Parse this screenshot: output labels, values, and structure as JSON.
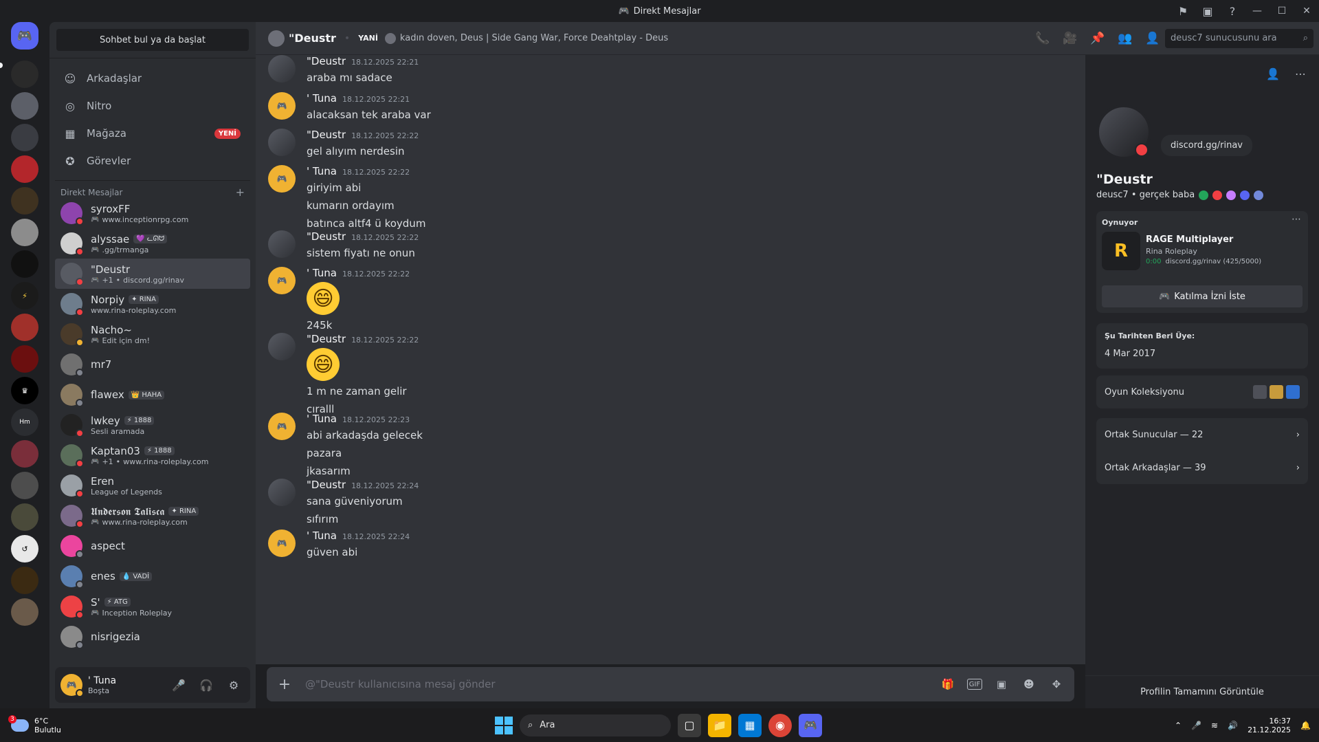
{
  "window": {
    "title": "Direkt Mesajlar"
  },
  "sidebar": {
    "find_button": "Sohbet bul ya da başlat",
    "nav": [
      {
        "label": "Arkadaşlar",
        "icon": "friends-icon"
      },
      {
        "label": "Nitro",
        "icon": "nitro-icon"
      },
      {
        "label": "Mağaza",
        "icon": "shop-icon",
        "badge": "YENİ"
      },
      {
        "label": "Görevler",
        "icon": "quests-icon"
      }
    ],
    "dm_header": "Direkt Mesajlar",
    "dms": [
      {
        "name": "syroxFF",
        "tag": "",
        "sub": "www.inceptionrpg.com",
        "color": "#8e44ad",
        "status": "dnd",
        "game": true,
        "extra": ""
      },
      {
        "name": "alyssae",
        "tag": "💜 ᓚᘏᗢ",
        "sub": ".gg/trmanga",
        "color": "#cfcfcf",
        "status": "dnd",
        "game": true,
        "extra": ""
      },
      {
        "name": "\"Deustr",
        "tag": "",
        "sub": "discord.gg/rinav",
        "color": "#585b63",
        "status": "dnd",
        "game": true,
        "extra": "+1",
        "active": true
      },
      {
        "name": "Norpiy",
        "tag": "✦ RINA",
        "sub": "www.rina-roleplay.com",
        "color": "#6e7d8c",
        "status": "dnd",
        "game": false,
        "extra": ""
      },
      {
        "name": "Nacho~",
        "tag": "",
        "sub": "Edit için dm!",
        "color": "#4a3b2a",
        "status": "idle",
        "game": true,
        "extra": ""
      },
      {
        "name": "mr7",
        "tag": "",
        "sub": "",
        "color": "#707070",
        "status": "off",
        "game": false,
        "extra": ""
      },
      {
        "name": "flawex",
        "tag": "👑 HAHA",
        "sub": "",
        "color": "#8a7a60",
        "status": "off",
        "game": false,
        "extra": ""
      },
      {
        "name": "lwkey",
        "tag": "⚡ 1888",
        "sub": "Sesli aramada",
        "color": "#222222",
        "status": "dnd",
        "game": false,
        "extra": ""
      },
      {
        "name": "Kaptan03",
        "tag": "⚡ 1888",
        "sub": "www.rina-roleplay.com",
        "color": "#5a6e5a",
        "status": "dnd",
        "game": true,
        "extra": "+1"
      },
      {
        "name": "Eren",
        "tag": "",
        "sub": "League of Legends",
        "color": "#9aa0a6",
        "status": "dnd",
        "game": false,
        "extra": ""
      },
      {
        "name": "𝖀𝖓𝖉𝖊𝖗𝖘𝖔𝖓 𝕿𝖆𝖑𝖎𝖘𝖈𝖆",
        "tag": "✦ RINA",
        "sub": "www.rina-roleplay.com",
        "color": "#7b6a8a",
        "status": "dnd",
        "game": true,
        "extra": ""
      },
      {
        "name": "aspect",
        "tag": "",
        "sub": "",
        "color": "#eb459e",
        "status": "off",
        "game": false,
        "extra": ""
      },
      {
        "name": "enes",
        "tag": "💧 VADİ",
        "sub": "",
        "color": "#5a7fb0",
        "status": "off",
        "game": false,
        "extra": ""
      },
      {
        "name": "S'",
        "tag": "⚡ ATG",
        "sub": "Inception Roleplay",
        "color": "#ed4245",
        "status": "dnd",
        "game": true,
        "extra": ""
      },
      {
        "name": "nisrigezia",
        "tag": "",
        "sub": "",
        "color": "#8a8a8a",
        "status": "off",
        "game": false,
        "extra": ""
      }
    ]
  },
  "user_panel": {
    "name": "' Tuna",
    "status": "Boşta"
  },
  "chat_header": {
    "name": "\"Deustr",
    "yeni": "YANİ",
    "status": "kadın doven, Deus | Side Gang War, Force Deahtplay - Deus",
    "search_placeholder": "deusc7 sunucusunu ara"
  },
  "messages": [
    {
      "author": "\"Deustr",
      "time": "18.12.2025 22:21",
      "lines": [
        "araba mı sadace"
      ],
      "av": "deustr"
    },
    {
      "author": "' Tuna",
      "time": "18.12.2025 22:21",
      "lines": [
        "alacaksan tek araba var"
      ],
      "av": "tuna"
    },
    {
      "author": "\"Deustr",
      "time": "18.12.2025 22:22",
      "lines": [
        "gel alıyım nerdesin"
      ],
      "av": "deustr"
    },
    {
      "author": "' Tuna",
      "time": "18.12.2025 22:22",
      "lines": [
        "giriyim abi",
        "kumarın ordayım",
        "batınca altf4 ü koydum"
      ],
      "av": "tuna"
    },
    {
      "author": "\"Deustr",
      "time": "18.12.2025 22:22",
      "lines": [
        "sistem fiyatı ne onun"
      ],
      "av": "deustr"
    },
    {
      "author": "' Tuna",
      "time": "18.12.2025 22:22",
      "lines": [
        "245k"
      ],
      "av": "tuna",
      "emoji": "😄"
    },
    {
      "author": "\"Deustr",
      "time": "18.12.2025 22:22",
      "lines": [
        "1 m ne zaman gelir",
        "cıralll"
      ],
      "av": "deustr",
      "emoji": "😄"
    },
    {
      "author": "' Tuna",
      "time": "18.12.2025 22:23",
      "lines": [
        "abi arkadaşda gelecek",
        "pazara",
        "jkasarım"
      ],
      "av": "tuna"
    },
    {
      "author": "\"Deustr",
      "time": "18.12.2025 22:24",
      "lines": [
        "sana güveniyorum",
        "sıfırım"
      ],
      "av": "deustr"
    },
    {
      "author": "' Tuna",
      "time": "18.12.2025 22:24",
      "lines": [
        "güven abi"
      ],
      "av": "tuna"
    }
  ],
  "composer": {
    "placeholder": "@\"Deustr kullanıcısına mesaj gönder"
  },
  "profile": {
    "bubble": "discord.gg/rinav",
    "name": "\"Deustr",
    "sub": "deusc7 • gerçek baba",
    "activity_title": "Oynuyor",
    "game_name": "RAGE Multiplayer",
    "game_detail": "Rina Roleplay",
    "game_time": "0:00",
    "game_party": "discord.gg/rinav (425/5000)",
    "join_label": "Katılma İzni İste",
    "member_since_label": "Şu Tarihten Beri Üye:",
    "member_since": "4 Mar 2017",
    "game_collection": "Oyun Koleksiyonu",
    "mutual_servers": "Ortak Sunucular — 22",
    "mutual_friends": "Ortak Arkadaşlar — 39",
    "view_full": "Profilin Tamamını Görüntüle"
  },
  "taskbar": {
    "temp": "6°C",
    "weather": "Bulutlu",
    "weather_badge": "3",
    "search": "Ara",
    "time": "16:37",
    "date": "21.12.2025"
  },
  "colors": {
    "accent": "#5865f2",
    "dnd": "#f23f43",
    "idle": "#f0b232",
    "online": "#23a55a"
  }
}
